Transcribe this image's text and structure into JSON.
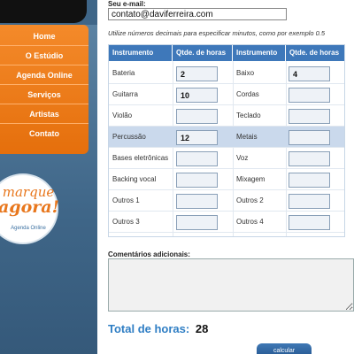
{
  "sidebar": {
    "menu": [
      "Home",
      "O Estúdio",
      "Agenda Online",
      "Serviços",
      "Artistas",
      "Contato"
    ],
    "logo": {
      "line1": "marque",
      "line2": "agora!",
      "sub": "Agenda Online"
    }
  },
  "form": {
    "email_label": "Seu e-mail:",
    "email_value": "contato@daviferreira.com",
    "hint": "Utilize números decimais para especificar minutos, como por exemplo 0.5",
    "table": {
      "headers": [
        "Instrumento",
        "Qtde. de horas",
        "Instrumento",
        "Qtde. de horas"
      ],
      "rows": [
        {
          "left": "Bateria",
          "left_val": "2",
          "right": "Baixo",
          "right_val": "4"
        },
        {
          "left": "Guitarra",
          "left_val": "10",
          "right": "Cordas",
          "right_val": ""
        },
        {
          "left": "Violão",
          "left_val": "",
          "right": "Teclado",
          "right_val": ""
        },
        {
          "left": "Percussão",
          "left_val": "12",
          "right": "Metais",
          "right_val": ""
        },
        {
          "left": "Bases eletrônicas",
          "left_val": "",
          "right": "Voz",
          "right_val": ""
        },
        {
          "left": "Backing vocal",
          "left_val": "",
          "right": "Mixagem",
          "right_val": ""
        },
        {
          "left": "Outros 1",
          "left_val": "",
          "right": "Outros 2",
          "right_val": ""
        },
        {
          "left": "Outros 3",
          "left_val": "",
          "right": "Outros 4",
          "right_val": ""
        }
      ]
    },
    "comments_label": "Comentários adicionais:",
    "total_label": "Total de horas:",
    "total_value": "28",
    "calc_button": "calcular"
  }
}
